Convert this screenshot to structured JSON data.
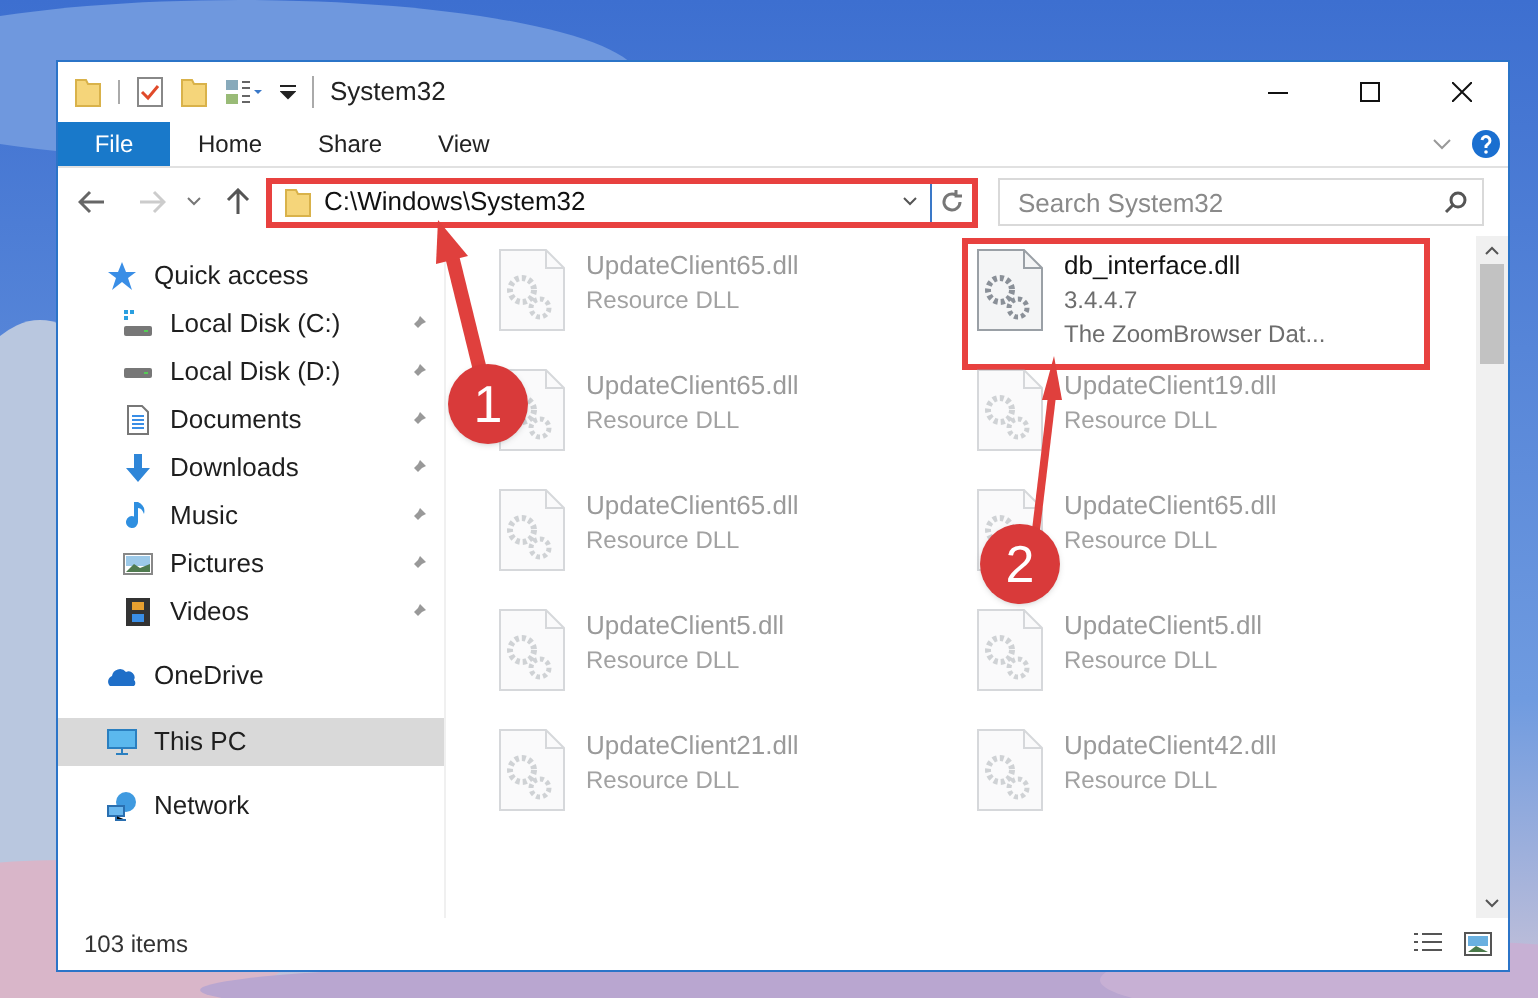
{
  "window": {
    "title": "System32"
  },
  "ribbon": {
    "file_button": "File",
    "tabs": [
      "Home",
      "Share",
      "View"
    ]
  },
  "address": {
    "path": "C:\\Windows\\System32",
    "highlighted": true
  },
  "search": {
    "placeholder": "Search System32"
  },
  "nav": [
    {
      "label": "Quick access",
      "kind": "star",
      "selected": false,
      "children": [
        {
          "label": "Local Disk (C:)",
          "kind": "drive_c",
          "pinned": true,
          "selected": false
        },
        {
          "label": "Local Disk (D:)",
          "kind": "drive",
          "pinned": true,
          "selected": false
        },
        {
          "label": "Documents",
          "kind": "documents",
          "pinned": true,
          "selected": false
        },
        {
          "label": "Downloads",
          "kind": "downloads",
          "pinned": true,
          "selected": false
        },
        {
          "label": "Music",
          "kind": "music",
          "pinned": true,
          "selected": false
        },
        {
          "label": "Pictures",
          "kind": "pictures",
          "pinned": true,
          "selected": false
        },
        {
          "label": "Videos",
          "kind": "videos",
          "pinned": true,
          "selected": false
        }
      ]
    },
    {
      "label": "OneDrive",
      "kind": "cloud",
      "selected": false
    },
    {
      "label": "This PC",
      "kind": "pc",
      "selected": true
    },
    {
      "label": "Network",
      "kind": "network",
      "selected": false
    }
  ],
  "files": [
    {
      "name": "UpdateClient65.dll",
      "lines": [
        "Resource DLL"
      ],
      "faded": true,
      "highlighted": false
    },
    {
      "name": "db_interface.dll",
      "lines": [
        "3.4.4.7",
        "The ZoomBrowser Dat..."
      ],
      "faded": false,
      "highlighted": true
    },
    {
      "name": "UpdateClient65.dll",
      "lines": [
        "Resource DLL"
      ],
      "faded": true,
      "highlighted": false
    },
    {
      "name": "UpdateClient19.dll",
      "lines": [
        "Resource DLL"
      ],
      "faded": true,
      "highlighted": false
    },
    {
      "name": "UpdateClient65.dll",
      "lines": [
        "Resource DLL"
      ],
      "faded": true,
      "highlighted": false
    },
    {
      "name": "UpdateClient65.dll",
      "lines": [
        "Resource DLL"
      ],
      "faded": true,
      "highlighted": false
    },
    {
      "name": "UpdateClient5.dll",
      "lines": [
        "Resource DLL"
      ],
      "faded": true,
      "highlighted": false
    },
    {
      "name": "UpdateClient5.dll",
      "lines": [
        "Resource DLL"
      ],
      "faded": true,
      "highlighted": false
    },
    {
      "name": "UpdateClient21.dll",
      "lines": [
        "Resource DLL"
      ],
      "faded": true,
      "highlighted": false
    },
    {
      "name": "UpdateClient42.dll",
      "lines": [
        "Resource DLL"
      ],
      "faded": true,
      "highlighted": false
    }
  ],
  "status_bar": {
    "item_count": "103 items"
  },
  "callouts": [
    {
      "label": "1"
    },
    {
      "label": "2"
    }
  ]
}
